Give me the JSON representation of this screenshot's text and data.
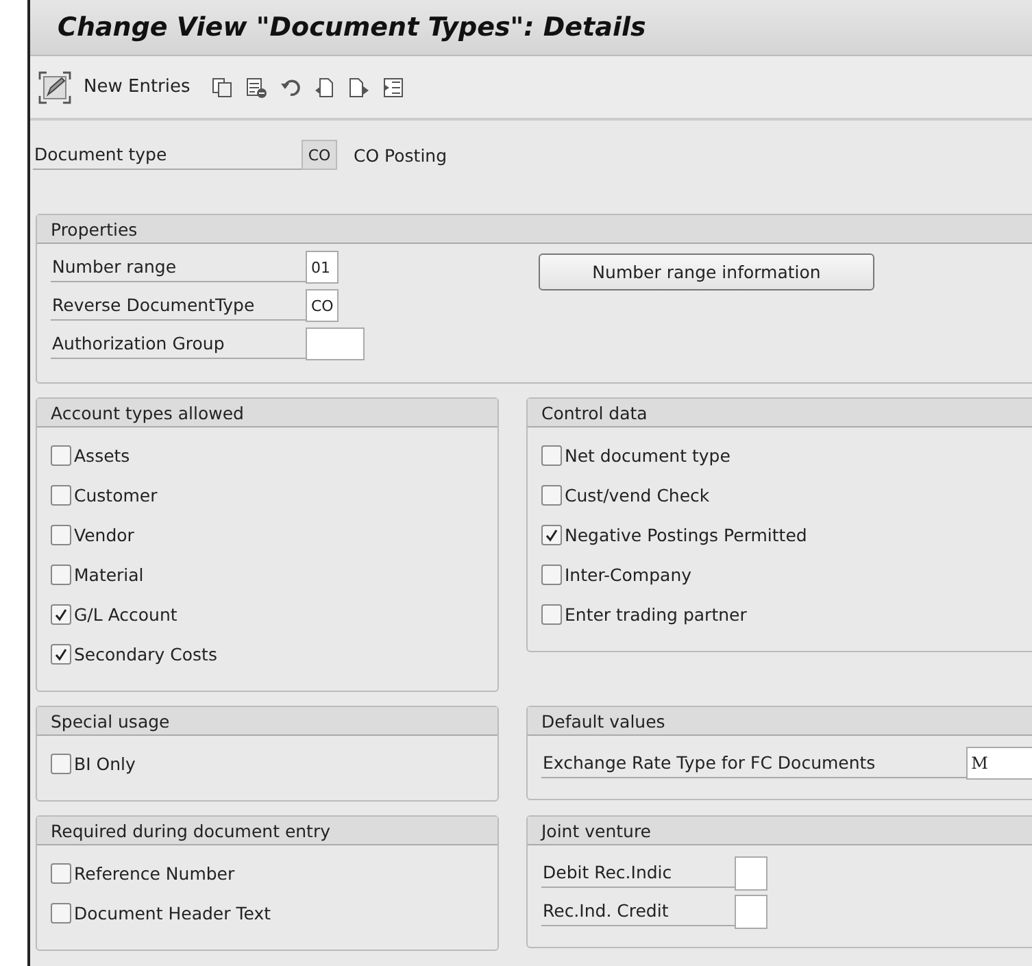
{
  "window": {
    "title": "Change View \"Document Types\": Details"
  },
  "toolbar": {
    "new_entries": "New Entries"
  },
  "document_type": {
    "label": "Document type",
    "value": "CO",
    "description": "CO Posting"
  },
  "properties": {
    "title": "Properties",
    "fields": [
      {
        "label": "Number range",
        "value": "01"
      },
      {
        "label": "Reverse DocumentType",
        "value": "CO"
      },
      {
        "label": "Authorization Group"
      }
    ],
    "button": "Number range information"
  },
  "group_rows": [
    [
      {
        "kind": "checkboxes",
        "title": "Account types allowed",
        "items": [
          {
            "label": "Assets",
            "checked": false
          },
          {
            "label": "Customer",
            "checked": false
          },
          {
            "label": "Vendor",
            "checked": false
          },
          {
            "label": "Material",
            "checked": false
          },
          {
            "label": "G/L Account",
            "checked": true
          },
          {
            "label": "Secondary Costs",
            "checked": true
          }
        ]
      },
      {
        "kind": "checkboxes",
        "title": "Control data",
        "items": [
          {
            "label": "Net document type",
            "checked": false
          },
          {
            "label": "Cust/vend Check",
            "checked": false
          },
          {
            "label": "Negative Postings Permitted",
            "checked": true
          },
          {
            "label": "Inter-Company",
            "checked": false
          },
          {
            "label": "Enter trading partner",
            "checked": false
          }
        ]
      }
    ],
    [
      {
        "kind": "checkboxes",
        "title": "Special usage",
        "items": [
          {
            "label": "BI Only",
            "checked": false
          }
        ]
      },
      {
        "kind": "fields",
        "title": "Default values",
        "fields": [
          {
            "label": "Exchange Rate Type for FC Documents",
            "value": "M"
          }
        ]
      }
    ],
    [
      {
        "kind": "checkboxes",
        "title": "Required during document entry",
        "items": [
          {
            "label": "Reference Number",
            "checked": false
          },
          {
            "label": "Document Header Text",
            "checked": false
          }
        ]
      },
      {
        "kind": "fields",
        "title": "Joint venture",
        "fields": [
          {
            "label": "Debit Rec.Indic"
          },
          {
            "label": "Rec.Ind. Credit"
          }
        ]
      }
    ]
  ]
}
